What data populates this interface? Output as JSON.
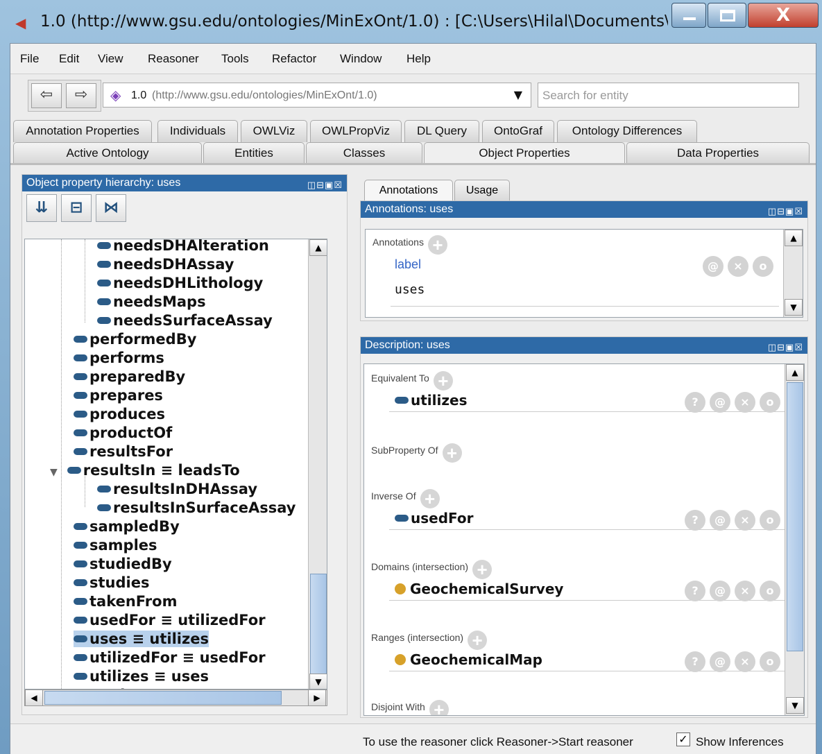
{
  "window": {
    "title": "1.0 (http://www.gsu.edu/ontologies/MinExOnt/1.0)  : [C:\\Users\\Hilal\\Documents\\..."
  },
  "menu": [
    "File",
    "Edit",
    "View",
    "Reasoner",
    "Tools",
    "Refactor",
    "Window",
    "Help"
  ],
  "toolbar": {
    "ontology_id": "1.0",
    "ontology_iri": "(http://www.gsu.edu/ontologies/MinExOnt/1.0)",
    "search_placeholder": "Search for entity"
  },
  "tabs_row1": [
    "Annotation Properties",
    "Individuals",
    "OWLViz",
    "OWLPropViz",
    "DL Query",
    "OntoGraf",
    "Ontology Differences"
  ],
  "tabs_row2": [
    "Active Ontology",
    "Entities",
    "Classes",
    "Object Properties",
    "Data Properties"
  ],
  "tabs_row2_selected": "Object Properties",
  "hierarchy": {
    "title": "Object property hierarchy: uses",
    "items": [
      "needsDHAlteration",
      "needsDHAssay",
      "needsDHLithology",
      "needsMaps",
      "needsSurfaceAssay",
      "performedBy",
      "performs",
      "preparedBy",
      "prepares",
      "produces",
      "productOf",
      "resultsFor",
      "resultsIn ≡ leadsTo",
      "resultsInDHAssay",
      "resultsInSurfaceAssay",
      "sampledBy",
      "samples",
      "studiedBy",
      "studies",
      "takenFrom",
      "usedFor ≡ utilizedFor",
      "uses ≡ utilizes",
      "utilizedFor ≡ usedFor",
      "utilizes ≡ uses",
      "worksFor"
    ],
    "selected": "uses ≡ utilizes"
  },
  "right_tabs": [
    "Annotations",
    "Usage"
  ],
  "annotations": {
    "title": "Annotations: uses",
    "section": "Annotations",
    "prop": "label",
    "value": "uses"
  },
  "description": {
    "title": "Description: uses",
    "equivalent_label": "Equivalent To",
    "equivalent": "utilizes",
    "subprop_label": "SubProperty Of",
    "inverse_label": "Inverse Of",
    "inverse": "usedFor",
    "domains_label": "Domains (intersection)",
    "domain": "GeochemicalSurvey",
    "ranges_label": "Ranges (intersection)",
    "range": "GeochemicalMap",
    "disjoint_label": "Disjoint With"
  },
  "status": {
    "message": "To use the reasoner click Reasoner->Start reasoner",
    "show_inferences": "Show Inferences"
  }
}
